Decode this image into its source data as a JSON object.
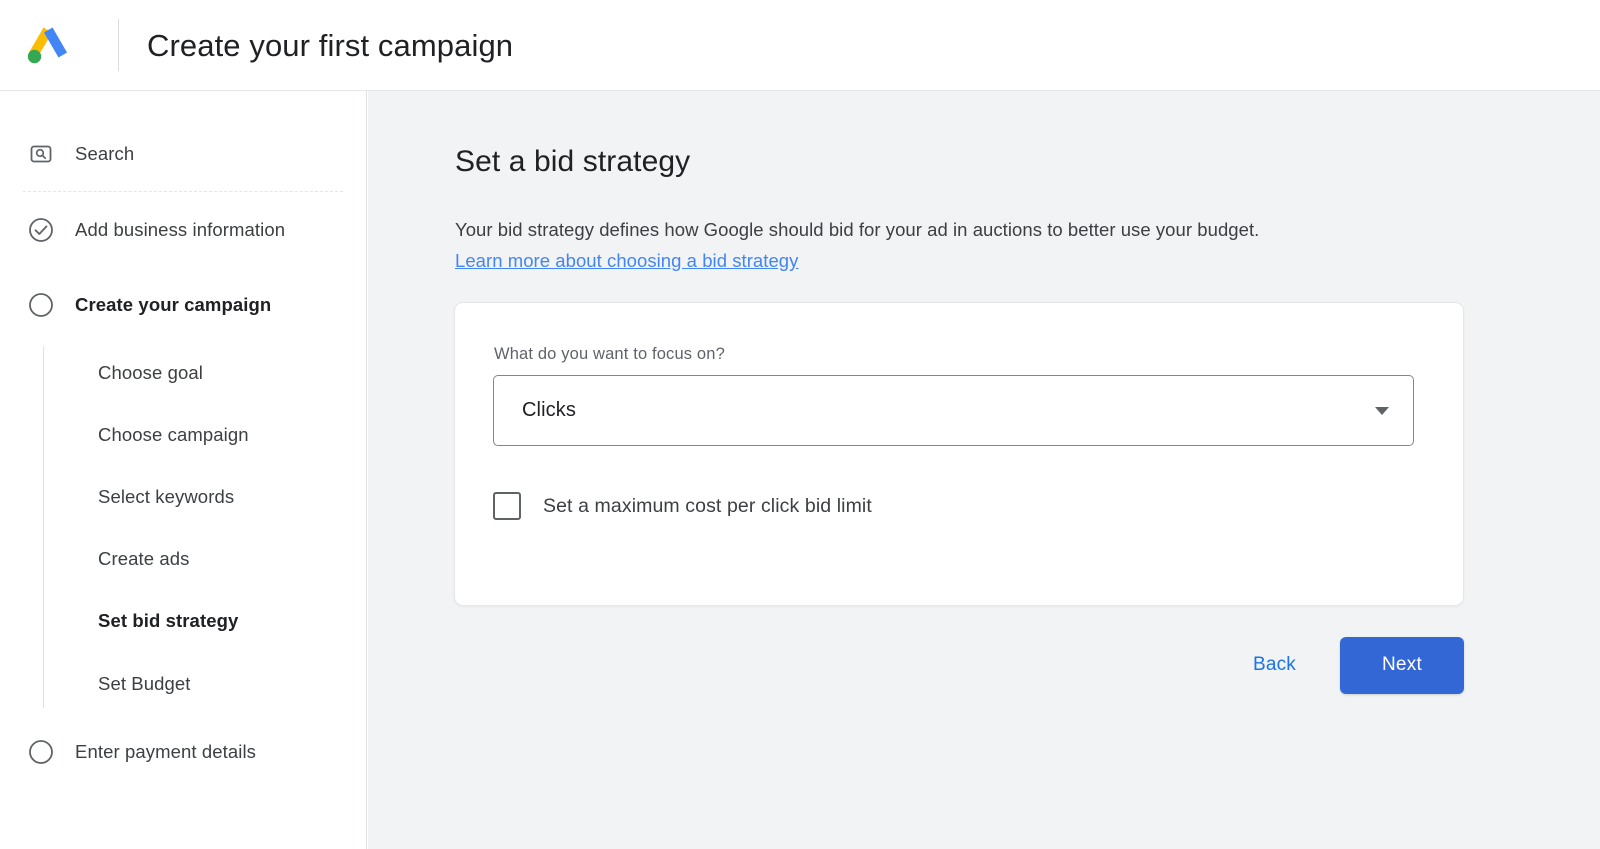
{
  "header": {
    "logo_name": "google-ads-logo",
    "logo_colors": {
      "yellow": "#FBBC04",
      "blue": "#4285F4",
      "green": "#34A853"
    },
    "title": "Create your first campaign"
  },
  "sidebar": {
    "search": {
      "label": "Search",
      "icon": "search-box-icon"
    },
    "steps": [
      {
        "label": "Add business information",
        "icon": "check-circle-icon",
        "state": "completed",
        "bold": false
      },
      {
        "label": "Create your campaign",
        "icon": "circle-icon",
        "state": "current",
        "bold": true
      },
      {
        "label": "Enter payment details",
        "icon": "circle-icon",
        "state": "pending",
        "bold": false
      }
    ],
    "substeps": [
      {
        "label": "Choose goal",
        "bold": false
      },
      {
        "label": "Choose campaign",
        "bold": false
      },
      {
        "label": "Select keywords",
        "bold": false
      },
      {
        "label": "Create ads",
        "bold": false
      },
      {
        "label": "Set bid strategy",
        "bold": true
      },
      {
        "label": "Set Budget",
        "bold": false
      }
    ]
  },
  "main": {
    "title": "Set a bid strategy",
    "description": "Your bid strategy defines how Google should bid for your ad in auctions to better use your budget.",
    "learn_more_link": "Learn more about choosing a bid strategy",
    "card": {
      "field_label": "What do you want to focus on?",
      "select_value": "Clicks",
      "select_icon": "chevron-down-icon",
      "checkbox_label": "Set a maximum cost per click bid limit",
      "checkbox_checked": false
    },
    "actions": {
      "back_label": "Back",
      "next_label": "Next",
      "next_color": "#3367d6",
      "back_color": "#1a73e8"
    }
  }
}
